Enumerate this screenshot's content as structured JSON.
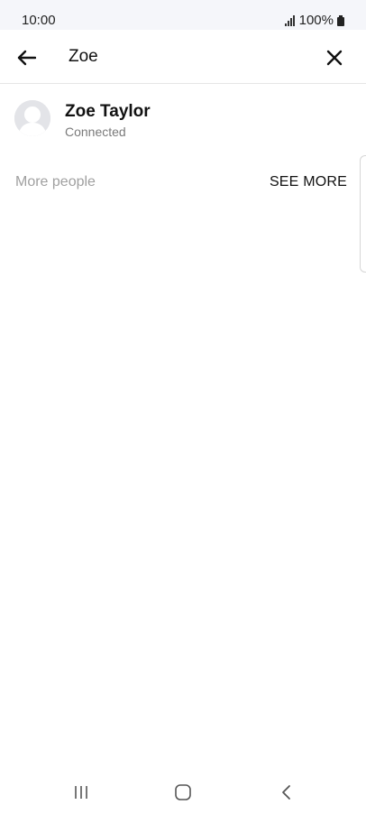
{
  "status_bar": {
    "time": "10:00",
    "battery": "100%",
    "icons": [
      "signal-icon",
      "battery-icon"
    ]
  },
  "search": {
    "value": "Zoe",
    "back_icon": "arrow-left-icon",
    "clear_icon": "close-icon"
  },
  "results": [
    {
      "name": "Zoe Taylor",
      "status": "Connected",
      "avatar_icon": "default-avatar-icon"
    }
  ],
  "more_people": {
    "label": "More people",
    "action": "SEE MORE"
  },
  "nav": {
    "icons": [
      "recents-icon",
      "home-icon",
      "back-chevron-icon"
    ]
  },
  "colors": {
    "status_bar_bg": "#f5f6fa",
    "text_primary": "#111111",
    "text_secondary": "#7a7a7a",
    "text_muted": "#a0a0a0",
    "avatar_bg": "#e3e4e8"
  }
}
